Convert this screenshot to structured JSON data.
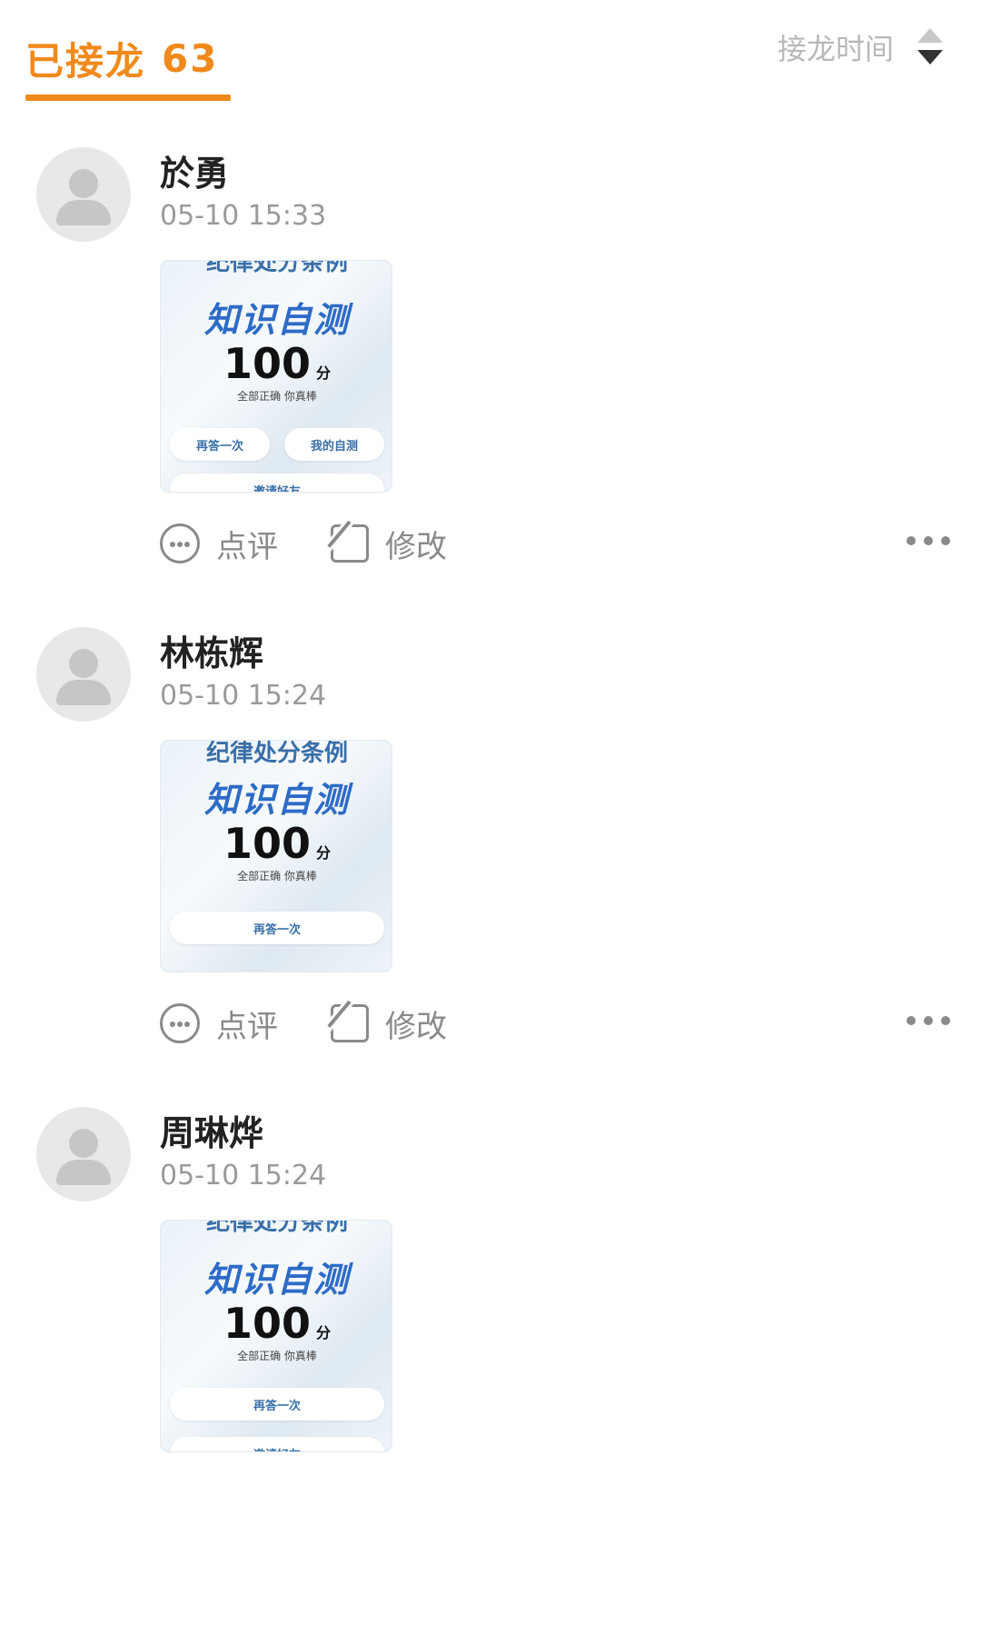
{
  "header": {
    "tab_label": "已接龙",
    "tab_count": "63",
    "sort_label": "接龙时间",
    "accent_color": "#f08a1c"
  },
  "entries": [
    {
      "name": "於勇",
      "time": "05-10 15:33",
      "thumb": {
        "top_text": "纪律处分条例",
        "title": "知识自测",
        "score": "100",
        "unit": "分",
        "praise": "全部正确 你真棒",
        "buttons": [
          "再答一次",
          "我的自测"
        ],
        "bottom_button": "邀请好友"
      },
      "comment_label": "点评",
      "edit_label": "修改"
    },
    {
      "name": "林栋辉",
      "time": "05-10 15:24",
      "thumb": {
        "top_text": "纪律处分条例",
        "title": "知识自测",
        "score": "100",
        "unit": "分",
        "praise": "全部正确 你真棒",
        "buttons": [
          "再答一次"
        ]
      },
      "comment_label": "点评",
      "edit_label": "修改"
    },
    {
      "name": "周琳烨",
      "time": "05-10 15:24",
      "thumb": {
        "top_text": "纪律处分条例",
        "title": "知识自测",
        "score": "100",
        "unit": "分",
        "praise": "全部正确 你真棒",
        "buttons": [
          "再答一次"
        ],
        "bottom_button": "邀请好友"
      }
    }
  ]
}
